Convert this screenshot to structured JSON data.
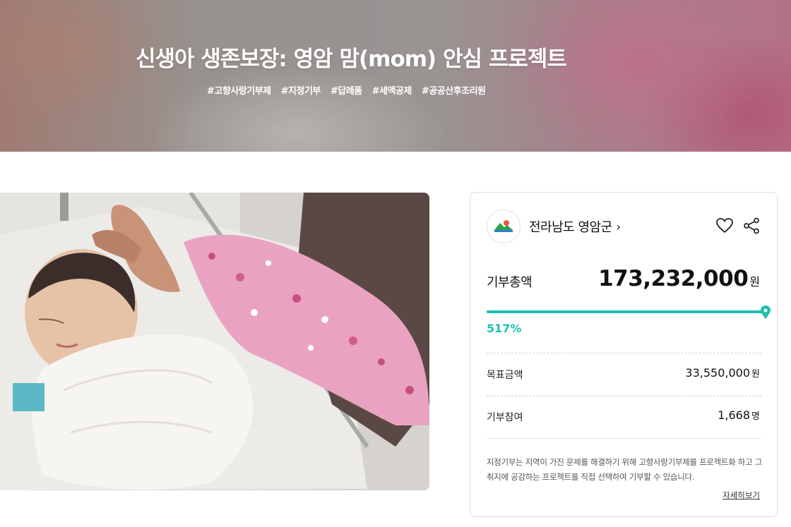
{
  "hero": {
    "title": "신생아 생존보장: 영암 맘(mom) 안심 프로젝트",
    "tags": [
      "#고향사랑기부제",
      "#지정기부",
      "#답례품",
      "#세액공제",
      "#공공산후조리원"
    ]
  },
  "organization": {
    "name": "전라남도 영암군",
    "arrow": "›",
    "logo_icon": "yeongam-county-logo-icon"
  },
  "actions": {
    "like_icon": "heart-icon",
    "share_icon": "share-icon"
  },
  "donation": {
    "total_label": "기부총액",
    "total_value": "173,232,000",
    "total_unit": "원",
    "progress_percent": 517,
    "progress_text": "517%",
    "goal_label": "목표금액",
    "goal_value": "33,550,000",
    "goal_unit": "원",
    "participants_label": "기부참여",
    "participants_value": "1,668",
    "participants_unit": "명"
  },
  "description": "지정기부는 지역이 가진 문제를 해결하기 위해 고향사랑기부제를 프로젝트화 하고 그 취지에 공감하는 프로젝트를 직접 선택하여 기부할 수 있습니다.",
  "more_link": "자세히보기",
  "colors": {
    "accent": "#1dbfae",
    "text": "#111111"
  }
}
